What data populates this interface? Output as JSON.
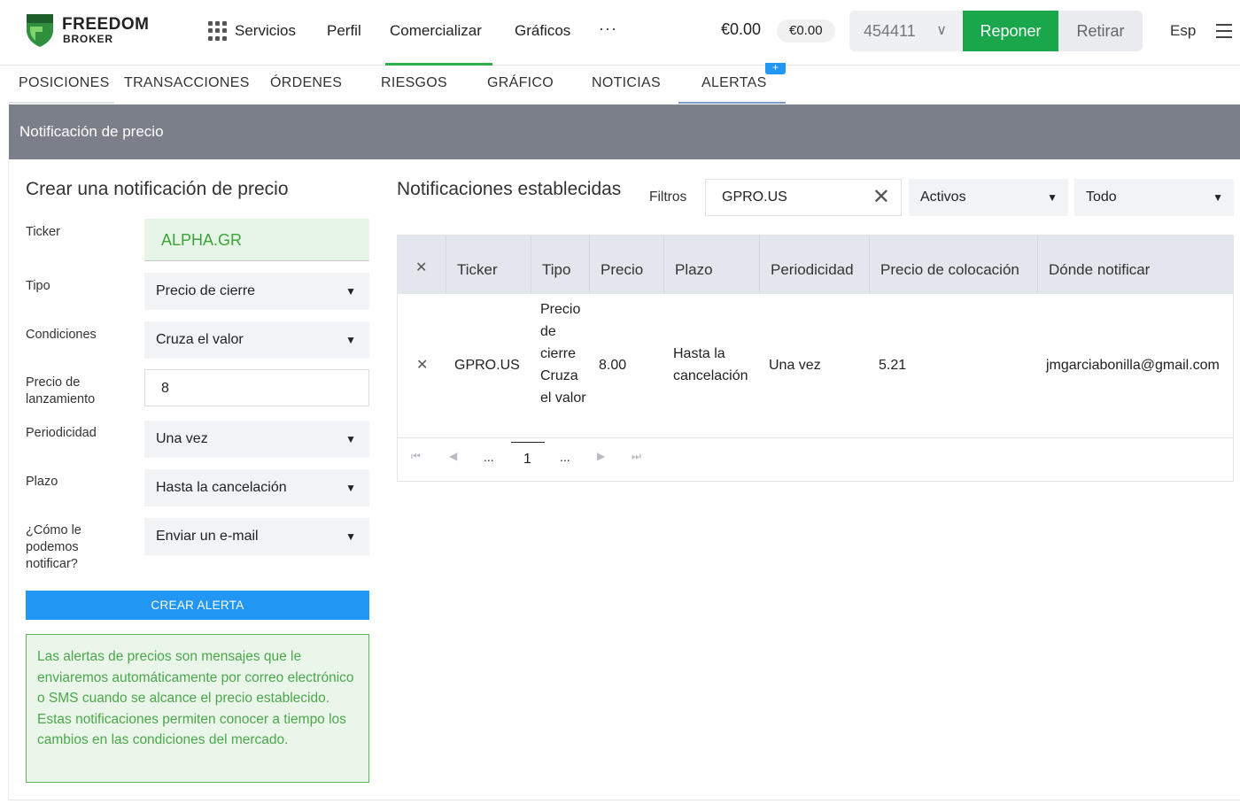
{
  "brand": {
    "line1": "FREEDOM",
    "line2": "BROKER",
    "accent": "#2db04b"
  },
  "nav": {
    "items": [
      "Servicios",
      "Perfil",
      "Comercializar",
      "Gráficos"
    ],
    "active": "Comercializar",
    "more": "···"
  },
  "account": {
    "balance": "€0.00",
    "balance_chip": "€0.00",
    "number": "454411",
    "reponer_label": "Reponer",
    "retirar_label": "Retirar",
    "language": "Esp"
  },
  "tabs": {
    "items": [
      "POSICIONES",
      "TRANSACCIONES",
      "ÓRDENES",
      "RIESGOS",
      "GRÁFICO",
      "NOTICIAS",
      "ALERTAS"
    ],
    "active": "ALERTAS",
    "badge": "+"
  },
  "panel": {
    "title": "Notificación de precio"
  },
  "form": {
    "title": "Crear una notificación de precio",
    "ticker_label": "Ticker",
    "ticker_value": "ALPHA.GR",
    "tipo_label": "Tipo",
    "tipo_value": "Precio de cierre",
    "condiciones_label": "Condiciones",
    "condiciones_value": "Cruza el valor",
    "precio_label": "Precio de lanzamiento",
    "precio_value": "8",
    "periodicidad_label": "Periodicidad",
    "periodicidad_value": "Una vez",
    "plazo_label": "Plazo",
    "plazo_value": "Hasta la cancelación",
    "notificar_label": "¿Cómo le podemos notificar?",
    "notificar_value": "Enviar un e-mail",
    "create_button": "CREAR ALERTA",
    "info_text": "Las alertas de precios son mensajes que le enviaremos automáticamente por correo electrónico o SMS cuando se alcance el precio establecido. Estas notificaciones permiten conocer a tiempo los cambios en las condiciones del mercado."
  },
  "notifications": {
    "title": "Notificaciones establecidas",
    "filters_label": "Filtros",
    "filter_value": "GPRO.US",
    "status_select": "Activos",
    "scope_select": "Todo",
    "columns": [
      "Ticker",
      "Tipo",
      "Precio",
      "Plazo",
      "Periodicidad",
      "Precio de colocación",
      "Dónde notificar"
    ],
    "rows": [
      {
        "ticker": "GPRO.US",
        "tipo": "Precio de cierre Cruza el valor",
        "precio": "8.00",
        "plazo": "Hasta la cancelación",
        "periodicidad": "Una vez",
        "precio_colocacion": "5.21",
        "donde": "jmgarciabonilla@gmail.com"
      }
    ],
    "pager": {
      "ellipsis_left": "...",
      "current": "1",
      "ellipsis_right": "..."
    }
  }
}
